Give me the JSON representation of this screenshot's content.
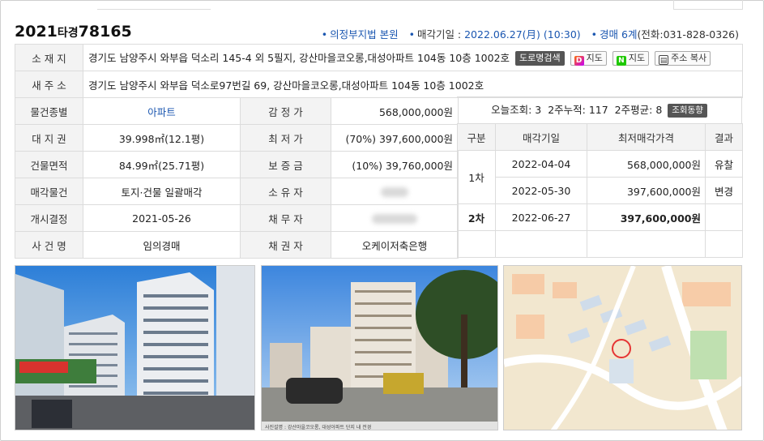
{
  "case": {
    "year": "2021",
    "type": "타경",
    "number": "78165"
  },
  "meta": {
    "court": "의정부지법 본원",
    "sale_date_label": "매각기일 :",
    "sale_date": "2022.06.27(月) (10:30)",
    "dept": "경매 6계",
    "phone": "(전화:031-828-0326)"
  },
  "info": {
    "location_label": "소 재 지",
    "location": "경기도 남양주시 와부읍 덕소리 145-4 외 5필지, 강산마을코오롱,대성아파트 104동 10층 1002호",
    "road_search": "도로명검색",
    "map_kakao": "지도",
    "map_naver": "지도",
    "copy_addr": "주소 복사",
    "new_addr_label": "새 주 소",
    "new_addr": "경기도 남양주시 와부읍 덕소로97번길 69, 강산마을코오롱,대성아파트 104동 10층 1002호",
    "rows": [
      {
        "label": "물건종별",
        "value": "아파트",
        "label2": "감 정 가",
        "value2": "568,000,000원"
      },
      {
        "label": "대 지 권",
        "value": "39.998㎡(12.1평)",
        "label2": "최 저 가",
        "value2": "(70%) 397,600,000원"
      },
      {
        "label": "건물면적",
        "value": "84.99㎡(25.71평)",
        "label2": "보 증 금",
        "value2": "(10%) 39,760,000원"
      },
      {
        "label": "매각물건",
        "value": "토지·건물 일괄매각",
        "label2": "소 유 자",
        "value2": ""
      },
      {
        "label": "개시결정",
        "value": "2021-05-26",
        "label2": "채 무 자",
        "value2": ""
      },
      {
        "label": "사 건 명",
        "value": "임의경매",
        "label2": "채 권 자",
        "value2": "오케이저축은행"
      }
    ]
  },
  "views": {
    "today_label": "오늘조회:",
    "today": "3",
    "twoweek_label": "2주누적:",
    "twoweek": "117",
    "avg_label": "2주평균:",
    "avg": "8",
    "trend_btn": "조회동향"
  },
  "history": {
    "headers": [
      "구분",
      "매각기일",
      "최저매각가격",
      "결과"
    ],
    "rows": [
      {
        "round": "1차",
        "date": "2022-04-04",
        "price": "568,000,000원",
        "result": "유찰"
      },
      {
        "round": "",
        "date": "2022-05-30",
        "price": "397,600,000원",
        "result": "변경"
      },
      {
        "round": "2차",
        "date": "2022-06-27",
        "price": "397,600,000원",
        "result": ""
      }
    ]
  },
  "photos": {
    "p2_caption": "사진설명 : 강산마을코오롱, 대성아파트 단지 내 전경"
  }
}
